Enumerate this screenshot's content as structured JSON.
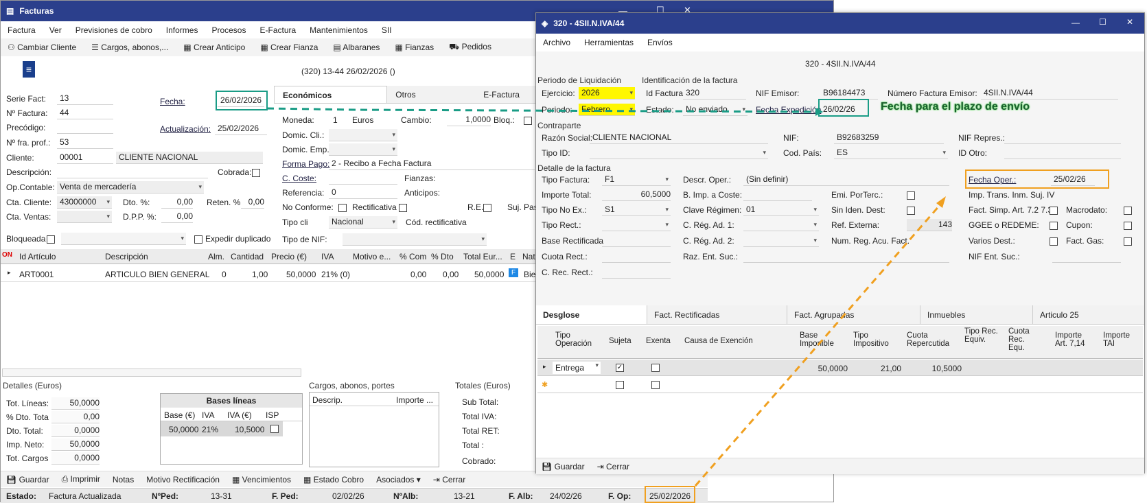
{
  "main": {
    "title": "Facturas",
    "menu": [
      "Factura",
      "Ver",
      "Previsiones de cobro",
      "Informes",
      "Procesos",
      "E-Factura",
      "Mantenimientos",
      "SII"
    ],
    "toolbar": [
      "Cambiar Cliente",
      "Cargos, abonos,...",
      "Crear Anticipo",
      "Crear Fianza",
      "Albaranes",
      "Fianzas",
      "Pedidos"
    ],
    "header_text": "(320) 13-44  26/02/2026  ()",
    "serie_label": "Serie Fact:",
    "serie": "13",
    "nfactura_label": "Nº Factura:",
    "nfactura": "44",
    "precodigo_label": "Precódigo:",
    "nfraprof_label": "Nº fra. prof.:",
    "nfraprof": "53",
    "cliente_label": "Cliente:",
    "cliente_code": "00001",
    "cliente_name": "CLIENTE NACIONAL",
    "descripcion_label": "Descripción:",
    "cobrada_label": "Cobrada:",
    "opcontable_label": "Op.Contable:",
    "opcontable": "Venta de mercadería",
    "ctacliente_label": "Cta. Cliente:",
    "ctacliente": "43000000",
    "dto_label": "Dto. %:",
    "dto": "0,00",
    "reten_label": "Reten. %",
    "reten": "0,00",
    "ctaventas_label": "Cta. Ventas:",
    "dpp_label": "D.P.P. %:",
    "dpp": "0,00",
    "bloqueada_label": "Bloqueada",
    "expedir_label": "Expedir duplicado",
    "fecha_label": "Fecha:",
    "fecha": "26/02/2026",
    "actualizacion_label": "Actualización:",
    "actualizacion": "25/02/2026",
    "tabs": [
      "Económicos",
      "Otros",
      "E-Factura"
    ],
    "moneda_label": "Moneda:",
    "moneda_num": "1",
    "moneda": "Euros",
    "cambio_label": "Cambio:",
    "cambio": "1,0000",
    "bloq_label": "Bloq.:",
    "domcli_label": "Domic. Cli.:",
    "domemp_label": "Domic. Emp.:",
    "formapago_label": "Forma Pago:",
    "formapago": "2 - Recibo a Fecha Factura",
    "ccoste_label": "C. Coste:",
    "fianzas_label": "Fianzas:",
    "referencia_label": "Referencia:",
    "referencia": "0",
    "anticipos_label": "Anticipos:",
    "noconforme_label": "No Conforme:",
    "rectificativa_label": "Rectificativa",
    "re_label": "R.E.:",
    "sujpas_label": "Suj. Pas",
    "tipocli_label": "Tipo cli",
    "tipocli": "Nacional",
    "codrect_label": "Cód. rectificativa",
    "tiponif_label": "Tipo de NIF:",
    "grid_cols": [
      "Id Artículo",
      "Descripción",
      "Alm.",
      "Cantidad",
      "Precio (€)",
      "IVA",
      "Motivo e...",
      "% Com",
      "% Dto",
      "Total Eur...",
      "E",
      "Nat"
    ],
    "grid_on": "ON",
    "grid_row": [
      "ART0001",
      "ARTICULO BIEN GENERAL",
      "0",
      "1,00",
      "50,0000",
      "21% (0)",
      "",
      "0,00",
      "0,00",
      "50,0000",
      "F",
      "Bie"
    ],
    "detalles_title": "Detalles (Euros)",
    "detalles": [
      [
        "Tot. Líneas:",
        "50,0000"
      ],
      [
        "% Dto. Tota",
        "0,00"
      ],
      [
        "Dto. Total:",
        "0,0000"
      ],
      [
        "Imp. Neto:",
        "50,0000"
      ],
      [
        "Tot. Cargos",
        "0,0000"
      ]
    ],
    "bases_title": "Bases líneas",
    "bases_cols": [
      "Base (€)",
      "IVA",
      "IVA (€)",
      "ISP"
    ],
    "bases_row": [
      "50,0000",
      "21%",
      "10,5000"
    ],
    "cargos_title": "Cargos, abonos, portes",
    "cargos_cols": [
      "Descrip.",
      "Importe ..."
    ],
    "totales_title": "Totales (Euros)",
    "totales": [
      "Sub Total:",
      "Total IVA:",
      "Total RET:",
      "Total :",
      "Cobrado:"
    ],
    "bottom_buttons": [
      "Guardar",
      "Imprimir",
      "Notas",
      "Motivo Rectificación",
      "Vencimientos",
      "Estado Cobro",
      "Asociados",
      "Cerrar"
    ],
    "status": [
      {
        "label": "Estado:",
        "value": "Factura Actualizada"
      },
      {
        "label": "NºPed:",
        "value": "13-31"
      },
      {
        "label": "F. Ped:",
        "value": "02/02/26"
      },
      {
        "label": "NºAlb:",
        "value": "13-21"
      },
      {
        "label": "F. Alb:",
        "value": "24/02/26"
      },
      {
        "label": "F. Op:",
        "value": "25/02/2026"
      }
    ]
  },
  "sii": {
    "title": "320 - 4SII.N.IVA/44",
    "menu": [
      "Archivo",
      "Herramientas",
      "Envíos"
    ],
    "header": "320 - 4SII.N.IVA/44",
    "periodo_title": "Periodo de Liquidación",
    "ident_title": "Identificación de la factura",
    "ejercicio_label": "Ejercicio:",
    "ejercicio": "2026",
    "periodo_label": "Periodo:",
    "periodo": "Febrero",
    "idfactura_label": "Id Factura",
    "idfactura": "320",
    "estado_label": "Estado:",
    "estado": "No enviado",
    "nifemisor_label": "NIF Emisor:",
    "nifemisor": "B96184473",
    "fechaexp_label": "Fecha Expedición",
    "fechaexp": "26/02/26",
    "numfact_label": "Número Factura Emisor:",
    "numfact": "4SII.N.IVA/44",
    "annotation": "Fecha para el plazo de envío",
    "contraparte_title": "Contraparte",
    "razon_label": "Razón Social:",
    "razon": "CLIENTE NACIONAL",
    "nif_label": "NIF:",
    "nif": "B92683259",
    "nifrepres_label": "NIF Repres.:",
    "tipoid_label": "Tipo ID:",
    "codpais_label": "Cod. País:",
    "codpais": "ES",
    "idotro_label": "ID Otro:",
    "detalle_title": "Detalle de la factura",
    "tipofactura_label": "Tipo Factura:",
    "tipofactura": "F1",
    "descroper_label": "Descr. Oper.:",
    "descroper": "(Sin definir)",
    "fechaoper_label": "Fecha Oper.:",
    "fechaoper": "25/02/26",
    "importetotal_label": "Importe Total:",
    "importetotal": "60,5000",
    "bimp_label": "B. Imp. a Coste:",
    "emiporterc_label": "Emi. PorTerc.:",
    "imptrans_label": "Imp. Trans. Inm. Suj. IV",
    "tiponoex_label": "Tipo No Ex.:",
    "tiponoex": "S1",
    "clavereg_label": "Clave Régimen:",
    "clavereg": "01",
    "siniden_label": "Sin Iden. Dest:",
    "factsimp_label": "Fact. Simp. Art. 7.2 7.3",
    "macrodato_label": "Macrodato:",
    "tiporect_label": "Tipo Rect.:",
    "cregad1_label": "C. Rég. Ad. 1:",
    "refext_label": "Ref. Externa:",
    "refext": "143",
    "ggee_label": "GGEE o REDEME:",
    "cupon_label": "Cupon:",
    "baserect_label": "Base Rectificada",
    "cregad2_label": "C. Rég. Ad. 2:",
    "numreg_label": "Num. Reg. Acu. Fact.",
    "variosdest_label": "Varios Dest.:",
    "factgas_label": "Fact. Gas:",
    "cuotarect_label": "Cuota Rect.:",
    "razent_label": "Raz. Ent. Suc.:",
    "nifent_label": "NIF Ent. Suc.:",
    "crecrect_label": "C. Rec. Rect.:",
    "tabs": [
      "Desglose",
      "Fact. Rectificadas",
      "Fact. Agrupadas",
      "Inmuebles",
      "Articulo 25"
    ],
    "grid_cols": [
      "Tipo Operación",
      "Sujeta",
      "Exenta",
      "Causa de Exención",
      "Base Imponible",
      "Tipo Impositivo",
      "Cuota Repercutida",
      "Tipo Rec. Equiv.",
      "Cuota Rec. Equ.",
      "Importe Art. 7,14",
      "Importe TAI"
    ],
    "grid_row": {
      "tipo": "Entrega",
      "base": "50,0000",
      "tipo_imp": "21,00",
      "cuota": "10,5000"
    },
    "buttons": [
      "Guardar",
      "Cerrar"
    ]
  },
  "colors": {
    "titlebar": "#2b3f8c",
    "highlight": "#fff700",
    "teal": "#1a9c86",
    "orange": "#f0a020"
  }
}
